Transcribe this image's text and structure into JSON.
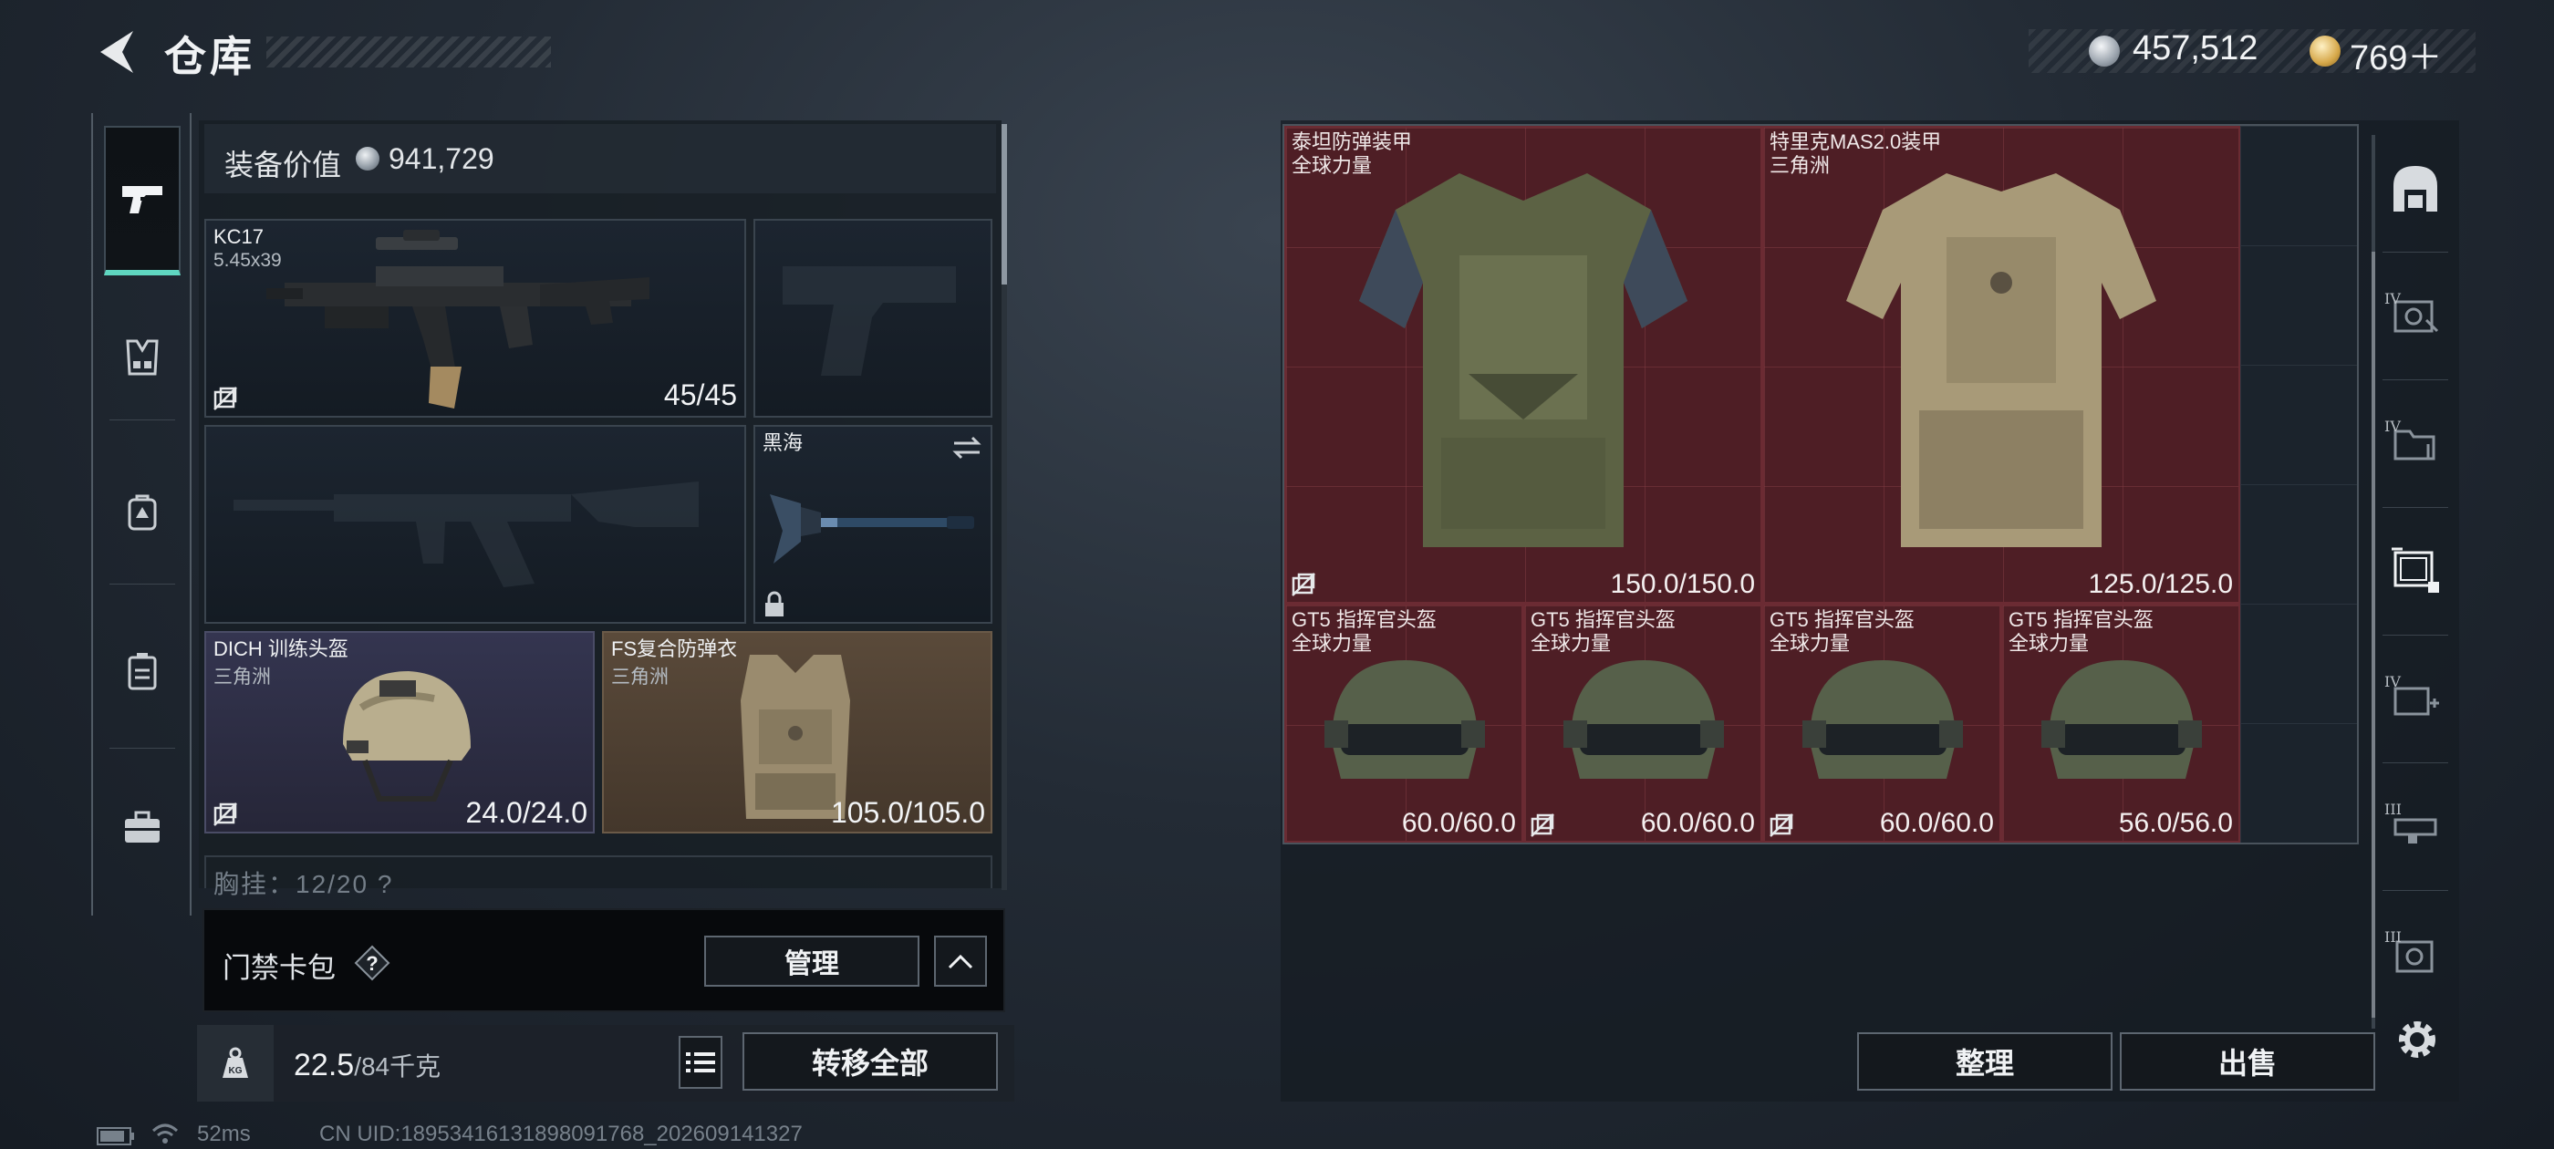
{
  "header": {
    "title": "仓库",
    "currency": [
      {
        "icon": "silver-coin-icon",
        "value": "457,512"
      },
      {
        "icon": "gold-coin-icon",
        "value": "769＋"
      }
    ]
  },
  "equipment": {
    "label": "装备价值",
    "value": "941,729",
    "slots": {
      "primary": {
        "name": "KC17",
        "caliber": "5.45x39",
        "ammo": "45/45"
      },
      "melee": {
        "name": "黑海"
      },
      "helmet": {
        "name": "DICH 训练头盔",
        "map": "三角洲",
        "durability": "24.0/24.0"
      },
      "armor": {
        "name": "FS复合防弹衣",
        "map": "三角洲",
        "durability": "105.0/105.0"
      }
    },
    "next_section": "胸挂：12/20  ?"
  },
  "card_bag": {
    "label": "门禁卡包",
    "help": "?",
    "manage": "管理"
  },
  "weight": {
    "current": "22.5",
    "max": "/84千克"
  },
  "buttons": {
    "transfer_all": "转移全部",
    "sort": "整理",
    "sell": "出售"
  },
  "status": {
    "ping": "52ms",
    "uid": "CN UID:1895341613189809​1768_202609141327"
  },
  "storage": {
    "items": [
      {
        "name": "泰坦防弹装甲",
        "sub": "全球力量",
        "durability": "150.0/150.0"
      },
      {
        "name": "特里克MAS2.0装甲",
        "sub": "三角洲",
        "durability": "125.0/125.0"
      },
      {
        "name": "GT5 指挥官头盔",
        "sub": "全球力量",
        "durability": "60.0/60.0"
      },
      {
        "name": "GT5 指挥官头盔",
        "sub": "全球力量",
        "durability": "60.0/60.0"
      },
      {
        "name": "GT5 指挥官头盔",
        "sub": "全球力量",
        "durability": "60.0/60.0"
      },
      {
        "name": "GT5 指挥官头盔",
        "sub": "全球力量",
        "durability": "56.0/56.0"
      }
    ],
    "tiers": [
      "IV",
      "IV",
      "IV",
      "III",
      "III"
    ]
  },
  "colors": {
    "accent": "#5fd6c0",
    "item_bg": "#4e1e25"
  }
}
